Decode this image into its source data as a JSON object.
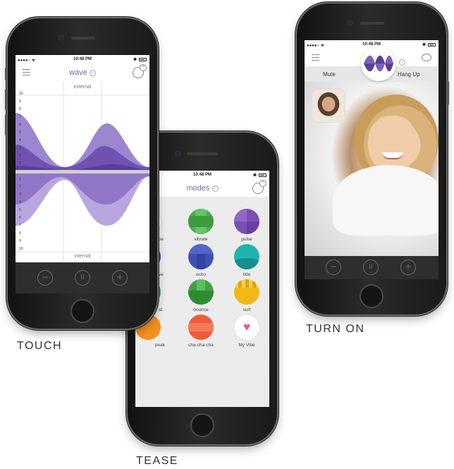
{
  "status_bar": {
    "time": "10:48 PM"
  },
  "touch": {
    "title": "wave",
    "label_top": "external",
    "label_bottom": "internal",
    "y_ticks_top": [
      "10",
      "9",
      "8",
      "7",
      "6",
      "5",
      "4",
      "3",
      "2",
      "1"
    ],
    "y_ticks_bottom": [
      "1",
      "2",
      "3",
      "4",
      "5",
      "6",
      "7",
      "8",
      "9",
      "10"
    ],
    "controls": [
      "−",
      "II",
      "+"
    ],
    "caption": "TOUCH"
  },
  "tease": {
    "title": "modes",
    "modes": [
      {
        "label": "vibe",
        "color": "#ffffff"
      },
      {
        "label": "vibrate",
        "color": "#4caf50"
      },
      {
        "label": "pulse",
        "color": "#7b4fb5"
      },
      {
        "label": "ve",
        "color": "#3f51b5"
      },
      {
        "label": "echo",
        "color": "#3f51b5"
      },
      {
        "label": "tide",
        "color": "#1fb3b0"
      },
      {
        "label": "st",
        "color": "#2bb06a"
      },
      {
        "label": "bounce",
        "color": "#43a047"
      },
      {
        "label": "surf",
        "color": "#f2b818"
      },
      {
        "label": "peak",
        "color": "#f5901e"
      },
      {
        "label": "cha-cha-cha",
        "color": "#ef5b3a"
      },
      {
        "label": "My Vibe",
        "color": "#ffffff"
      }
    ],
    "caption": "TEASE"
  },
  "turn_on": {
    "mute_label": "Mute",
    "hangup_label": "Hang Up",
    "controls": [
      "−",
      "II",
      "+"
    ],
    "caption": "TURN ON"
  }
}
